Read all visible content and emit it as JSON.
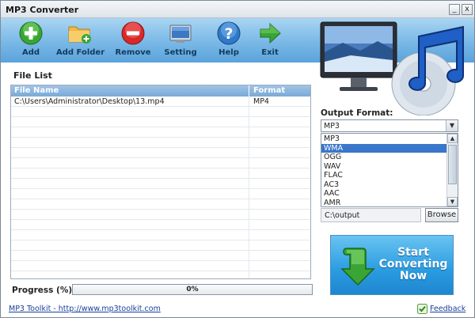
{
  "window": {
    "title": "MP3 Converter",
    "minimize_glyph": "_",
    "close_glyph": "x"
  },
  "toolbar": {
    "items": [
      {
        "label": "Add",
        "icon": "add-icon"
      },
      {
        "label": "Add Folder",
        "icon": "add-folder-icon"
      },
      {
        "label": "Remove",
        "icon": "remove-icon"
      },
      {
        "label": "Setting",
        "icon": "setting-icon"
      },
      {
        "label": "Help",
        "icon": "help-icon"
      },
      {
        "label": "Exit",
        "icon": "exit-icon"
      }
    ]
  },
  "file_list": {
    "title": "File List",
    "columns": [
      "File Name",
      "Format"
    ],
    "rows": [
      {
        "name": "C:\\Users\\Administrator\\Desktop\\13.mp4",
        "format": "MP4"
      }
    ]
  },
  "progress": {
    "label": "Progress (%):",
    "value": 0,
    "text": "0%"
  },
  "output": {
    "label": "Output Format:",
    "selected": "MP3",
    "options": [
      "MP3",
      "WMA",
      "OGG",
      "WAV",
      "FLAC",
      "AC3",
      "AAC",
      "AMR"
    ],
    "highlighted": "WMA",
    "path": "C:\\output",
    "browse_label": "Browse"
  },
  "start_button": {
    "line1": "Start",
    "line2": "Converting",
    "line3": "Now"
  },
  "footer": {
    "link": "MP3 Toolkit - http://www.mp3toolkit.com",
    "feedback": "Feedback"
  },
  "colors": {
    "toolbar": "#79b8e6",
    "start": "#2a9be0",
    "selection": "#3a76c9",
    "progress": "#7ab84a"
  }
}
